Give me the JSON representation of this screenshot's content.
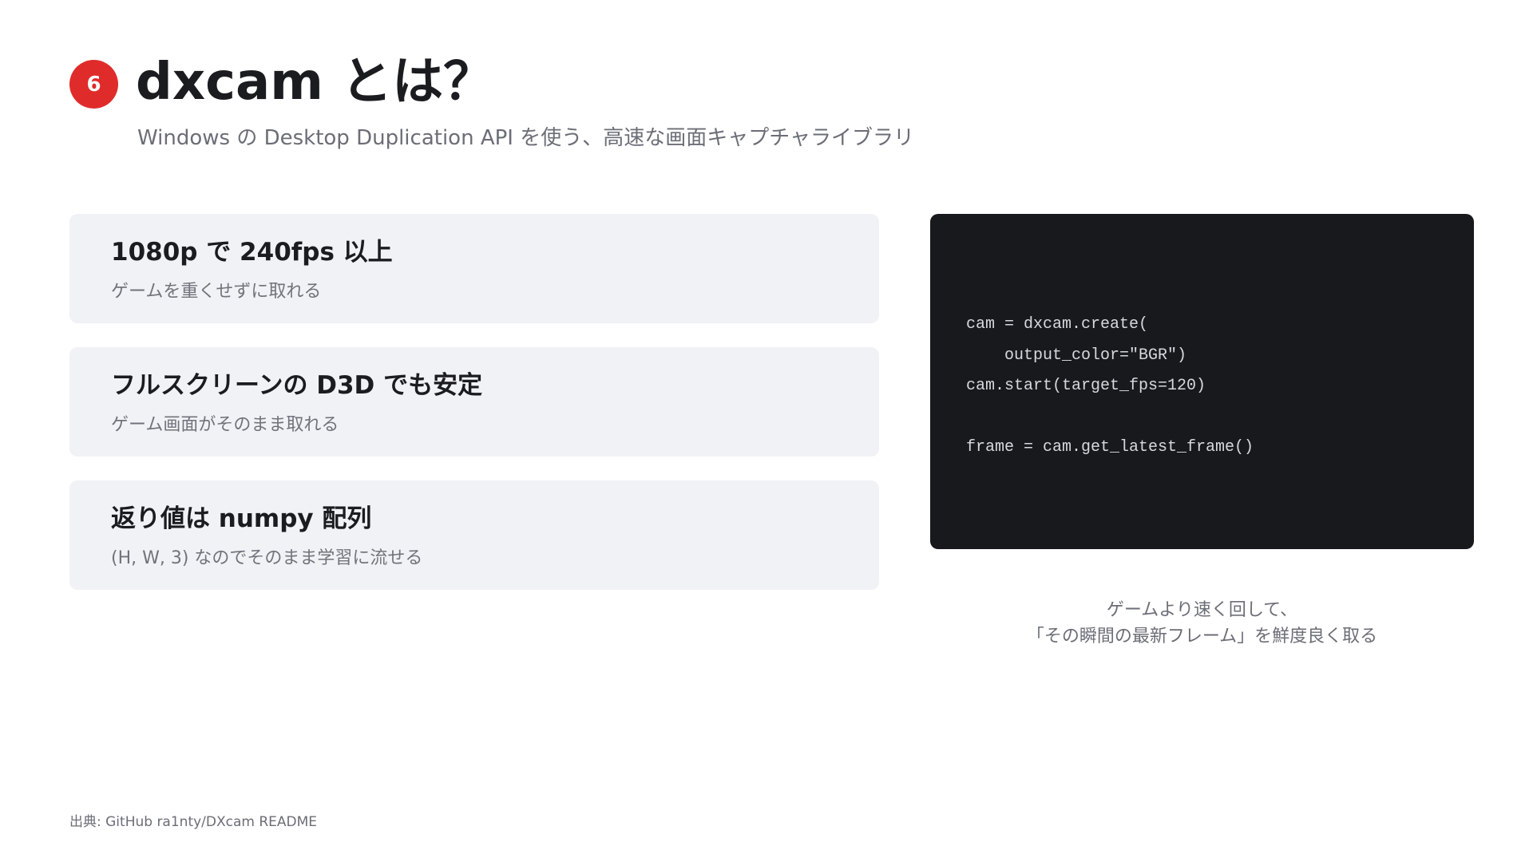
{
  "slide": {
    "number": "6",
    "title": "dxcam とは？",
    "subtitle": "Windows の Desktop Duplication API を使う、高速な画面キャプチャライブラリ",
    "accent_color": "#e02b2b"
  },
  "features": [
    {
      "title": "1080p で 240fps 以上",
      "desc": "ゲームを重くせずに取れる"
    },
    {
      "title": "フルスクリーンの D3D でも安定",
      "desc": "ゲーム画面がそのまま取れる"
    },
    {
      "title": "返り値は numpy 配列",
      "desc": "(H, W, 3) なのでそのまま学習に流せる"
    }
  ],
  "code": {
    "lines": [
      "cam = dxcam.create(",
      "    output_color=\"BGR\")",
      "cam.start(target_fps=120)",
      "",
      "frame = cam.get_latest_frame()"
    ]
  },
  "caption": {
    "line1": "ゲームより速く回して、",
    "line2": "「その瞬間の最新フレーム」を鮮度良く取る"
  },
  "source": "出典: GitHub ra1nty/DXcam README"
}
